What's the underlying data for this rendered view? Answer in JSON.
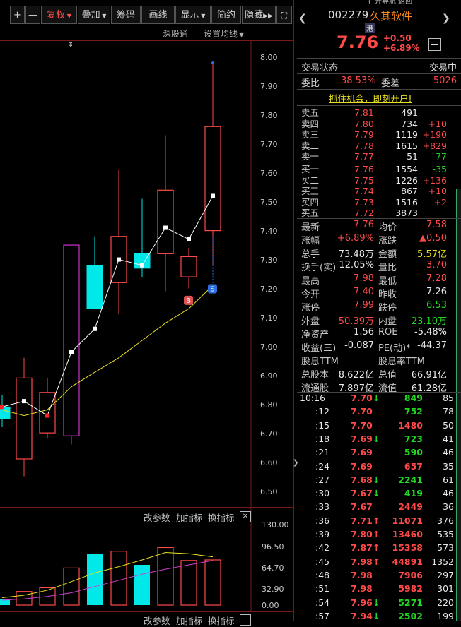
{
  "top_strip": "打开导航   返回",
  "toolbar": {
    "plus": "+",
    "minus": "—",
    "fuquan": "复权",
    "diejia": "叠加",
    "chouma": "筹码",
    "huaxian": "画线",
    "xianshi": "显示",
    "jianyue": "简约",
    "yincang": "隐藏",
    "expand": "⛶"
  },
  "chart_header": {
    "shengutong": "深股通",
    "set_ma": "设置均线"
  },
  "price_axis": [
    "8.00",
    "7.90",
    "7.80",
    "7.70",
    "7.60",
    "7.50",
    "7.40",
    "7.30",
    "7.20",
    "7.10",
    "7.00",
    "6.90",
    "6.80",
    "6.70",
    "6.60",
    "6.50"
  ],
  "chart_data": {
    "type": "candlestick",
    "ylim": [
      6.45,
      8.05
    ],
    "candles": [
      {
        "o": 6.79,
        "h": 6.83,
        "l": 6.72,
        "c": 6.75
      },
      {
        "o": 6.61,
        "h": 6.96,
        "l": 6.55,
        "c": 6.89
      },
      {
        "o": 6.7,
        "h": 6.89,
        "l": 6.68,
        "c": 6.84
      },
      {
        "o": 6.69,
        "h": 7.35,
        "l": 6.66,
        "c": 7.35
      },
      {
        "o": 7.28,
        "h": 7.38,
        "l": 7.17,
        "c": 7.13
      },
      {
        "o": 7.22,
        "h": 7.61,
        "l": 7.11,
        "c": 7.38
      },
      {
        "o": 7.32,
        "h": 7.51,
        "l": 7.24,
        "c": 7.27
      },
      {
        "o": 7.32,
        "h": 7.73,
        "l": 7.19,
        "c": 7.54
      },
      {
        "o": 7.24,
        "h": 7.34,
        "l": 7.2,
        "c": 7.31
      },
      {
        "o": 7.4,
        "h": 7.98,
        "l": 7.28,
        "c": 7.76
      }
    ],
    "avg_line": [
      6.79,
      6.81,
      6.76,
      6.98,
      7.06,
      7.3,
      7.28,
      7.41,
      7.37,
      7.52
    ],
    "ma_line": [
      6.78,
      6.76,
      6.78,
      6.86,
      6.91,
      6.96,
      7.02,
      7.08,
      7.13,
      7.21
    ],
    "markers": {
      "B": "B",
      "S": "S"
    },
    "volume": {
      "ylim": [
        0,
        130
      ],
      "values": [
        10,
        22,
        28,
        60,
        83,
        87,
        65,
        93,
        72,
        73
      ],
      "ma1": [
        12,
        16,
        24,
        38,
        52,
        62,
        73,
        85,
        83,
        78
      ],
      "ma2": [
        8,
        10,
        14,
        20,
        30,
        40,
        50,
        58,
        65,
        72
      ]
    }
  },
  "volume_header": {
    "gaicanshu": "改参数",
    "jiazhibiao": "加指标",
    "huanzhibiao": "换指标",
    "close": "✕"
  },
  "volume_axis": [
    "130.00",
    "96.50",
    "64.70",
    "32.90",
    "0.00"
  ],
  "bottom_header": {
    "gaicanshu": "改参数",
    "jiazhibiao": "加指标",
    "huanzhibiao": "换指标"
  },
  "stock": {
    "code": "002279",
    "name": "久其软件",
    "tag": "港",
    "price": "7.76",
    "change": "+0.50",
    "change_pct": "+6.89%"
  },
  "status": {
    "label": "交易状态",
    "value": "交易中"
  },
  "weibi": {
    "label1": "委比",
    "value1": "38.53%",
    "label2": "委差",
    "value2": "5026"
  },
  "promo": "抓住机会，即刻开户!",
  "asks": [
    {
      "label": "卖五",
      "price": "7.81",
      "vol": "491",
      "chg": ""
    },
    {
      "label": "卖四",
      "price": "7.80",
      "vol": "734",
      "chg": "+10"
    },
    {
      "label": "卖三",
      "price": "7.79",
      "vol": "1119",
      "chg": "+190"
    },
    {
      "label": "卖二",
      "price": "7.78",
      "vol": "1615",
      "chg": "+829"
    },
    {
      "label": "卖一",
      "price": "7.77",
      "vol": "51",
      "chg": "-77"
    }
  ],
  "bids": [
    {
      "label": "买一",
      "price": "7.76",
      "vol": "1554",
      "chg": "-35"
    },
    {
      "label": "买二",
      "price": "7.75",
      "vol": "1226",
      "chg": "+136"
    },
    {
      "label": "买三",
      "price": "7.74",
      "vol": "867",
      "chg": "+10"
    },
    {
      "label": "买四",
      "price": "7.73",
      "vol": "1516",
      "chg": "+2"
    },
    {
      "label": "买五",
      "price": "7.72",
      "vol": "3873",
      "chg": ""
    }
  ],
  "stats": [
    {
      "l1": "最新",
      "v1": "7.76",
      "l2": "均价",
      "v2": "7.58"
    },
    {
      "l1": "涨幅",
      "v1": "+6.89%",
      "l2": "涨跌",
      "v2": "▲0.50"
    },
    {
      "l1": "总手",
      "v1": "73.48万",
      "l2": "金额",
      "v2": "5.57亿"
    },
    {
      "l1": "换手(实)",
      "v1": "12.05%",
      "l2": "量比",
      "v2": "3.70"
    },
    {
      "l1": "最高",
      "v1": "7.98",
      "l2": "最低",
      "v2": "7.28"
    },
    {
      "l1": "今开",
      "v1": "7.40",
      "l2": "昨收",
      "v2": "7.26"
    },
    {
      "l1": "涨停",
      "v1": "7.99",
      "l2": "跌停",
      "v2": "6.53"
    },
    {
      "l1": "外盘",
      "v1": "50.39万",
      "l2": "内盘",
      "v2": "23.10万"
    },
    {
      "l1": "净资产",
      "v1": "1.56",
      "l2": "ROE",
      "v2": "-5.48%"
    },
    {
      "l1": "收益(三)",
      "v1": "-0.087",
      "l2": "PE(动)*",
      "v2": "-44.37"
    },
    {
      "l1": "股息TTM",
      "v1": "—",
      "l2": "股息率TTM",
      "v2": "—"
    },
    {
      "l1": "总股本",
      "v1": "8.622亿",
      "l2": "总值",
      "v2": "66.91亿"
    },
    {
      "l1": "流通股",
      "v1": "7.897亿",
      "l2": "流值",
      "v2": "61.28亿"
    }
  ],
  "ticks": [
    {
      "t": "10:16",
      "p": "7.70",
      "a": "↓",
      "v": "849",
      "n": "85"
    },
    {
      "t": ":12",
      "p": "7.70",
      "a": "",
      "v": "752",
      "n": "78"
    },
    {
      "t": ":15",
      "p": "7.70",
      "a": "",
      "v": "1480",
      "n": "50"
    },
    {
      "t": ":18",
      "p": "7.69",
      "a": "↓",
      "v": "723",
      "n": "41"
    },
    {
      "t": ":21",
      "p": "7.69",
      "a": "",
      "v": "590",
      "n": "46"
    },
    {
      "t": ":24",
      "p": "7.69",
      "a": "",
      "v": "657",
      "n": "35"
    },
    {
      "t": ":27",
      "p": "7.68",
      "a": "↓",
      "v": "2241",
      "n": "61"
    },
    {
      "t": ":30",
      "p": "7.67",
      "a": "↓",
      "v": "419",
      "n": "46"
    },
    {
      "t": ":33",
      "p": "7.67",
      "a": "",
      "v": "2449",
      "n": "36"
    },
    {
      "t": ":36",
      "p": "7.71",
      "a": "↑",
      "v": "11071",
      "n": "376"
    },
    {
      "t": ":39",
      "p": "7.80",
      "a": "↑",
      "v": "13460",
      "n": "535"
    },
    {
      "t": ":42",
      "p": "7.87",
      "a": "↑",
      "v": "15358",
      "n": "573"
    },
    {
      "t": ":45",
      "p": "7.98",
      "a": "↑",
      "v": "44891",
      "n": "1352"
    },
    {
      "t": ":48",
      "p": "7.98",
      "a": "",
      "v": "7906",
      "n": "297"
    },
    {
      "t": ":51",
      "p": "7.98",
      "a": "",
      "v": "5982",
      "n": "301"
    },
    {
      "t": ":54",
      "p": "7.96",
      "a": "↓",
      "v": "5271",
      "n": "220"
    },
    {
      "t": ":57",
      "p": "7.94",
      "a": "↓",
      "v": "2502",
      "n": "199"
    }
  ]
}
